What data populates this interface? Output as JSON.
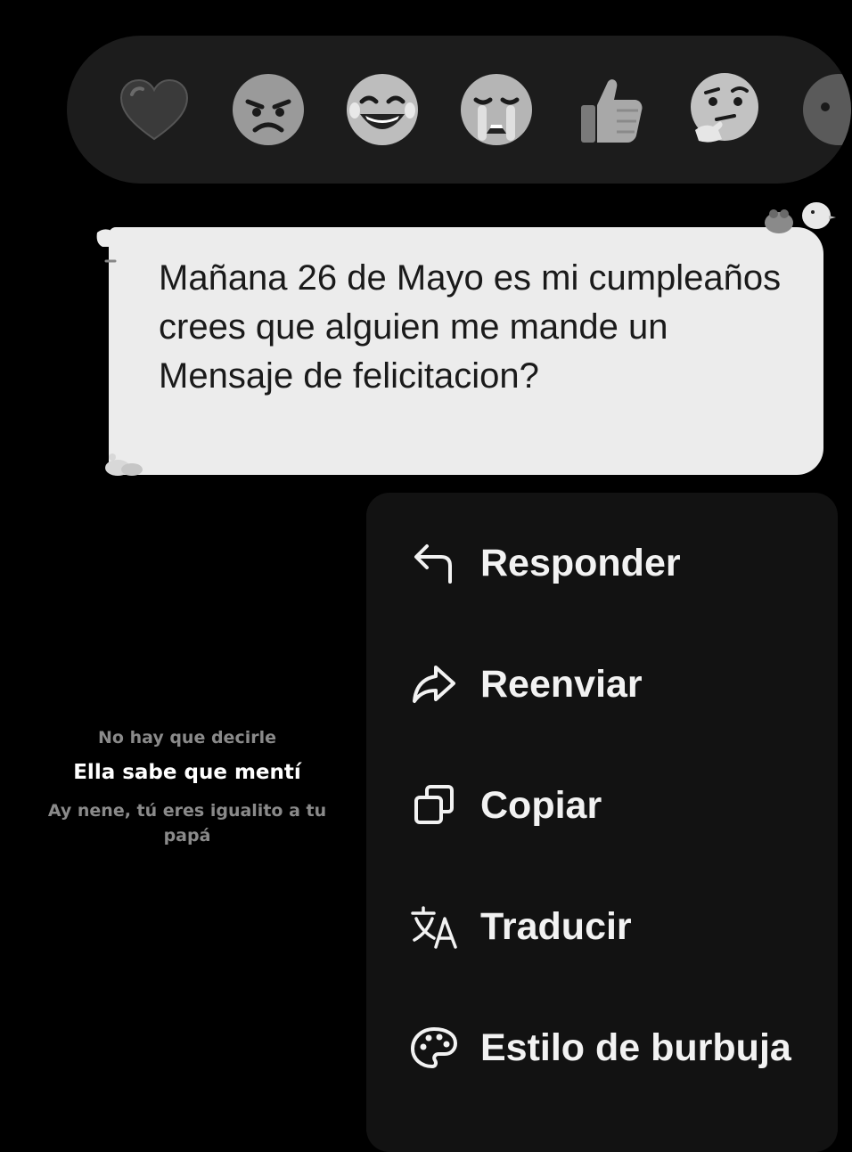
{
  "reactions": [
    {
      "icon": "heart-icon"
    },
    {
      "icon": "angry-face-icon"
    },
    {
      "icon": "laughing-face-icon"
    },
    {
      "icon": "crying-face-icon"
    },
    {
      "icon": "thumbs-up-icon"
    },
    {
      "icon": "thinking-face-icon"
    },
    {
      "icon": "more-reactions-icon"
    }
  ],
  "message": {
    "text": "Mañana 26 de Mayo es mi cumpleaños crees que alguien me mande un Mensaje de felicitacion?"
  },
  "menu": {
    "items": [
      {
        "label": "Responder",
        "icon": "reply-icon"
      },
      {
        "label": "Reenviar",
        "icon": "forward-icon"
      },
      {
        "label": "Copiar",
        "icon": "copy-icon"
      },
      {
        "label": "Traducir",
        "icon": "translate-icon"
      },
      {
        "label": "Estilo de burbuja",
        "icon": "palette-icon"
      }
    ]
  },
  "lyrics": {
    "previous": "No hay que decirle",
    "current": "Ella sabe que mentí",
    "next": "Ay nene, tú eres igualito a tu papá"
  }
}
